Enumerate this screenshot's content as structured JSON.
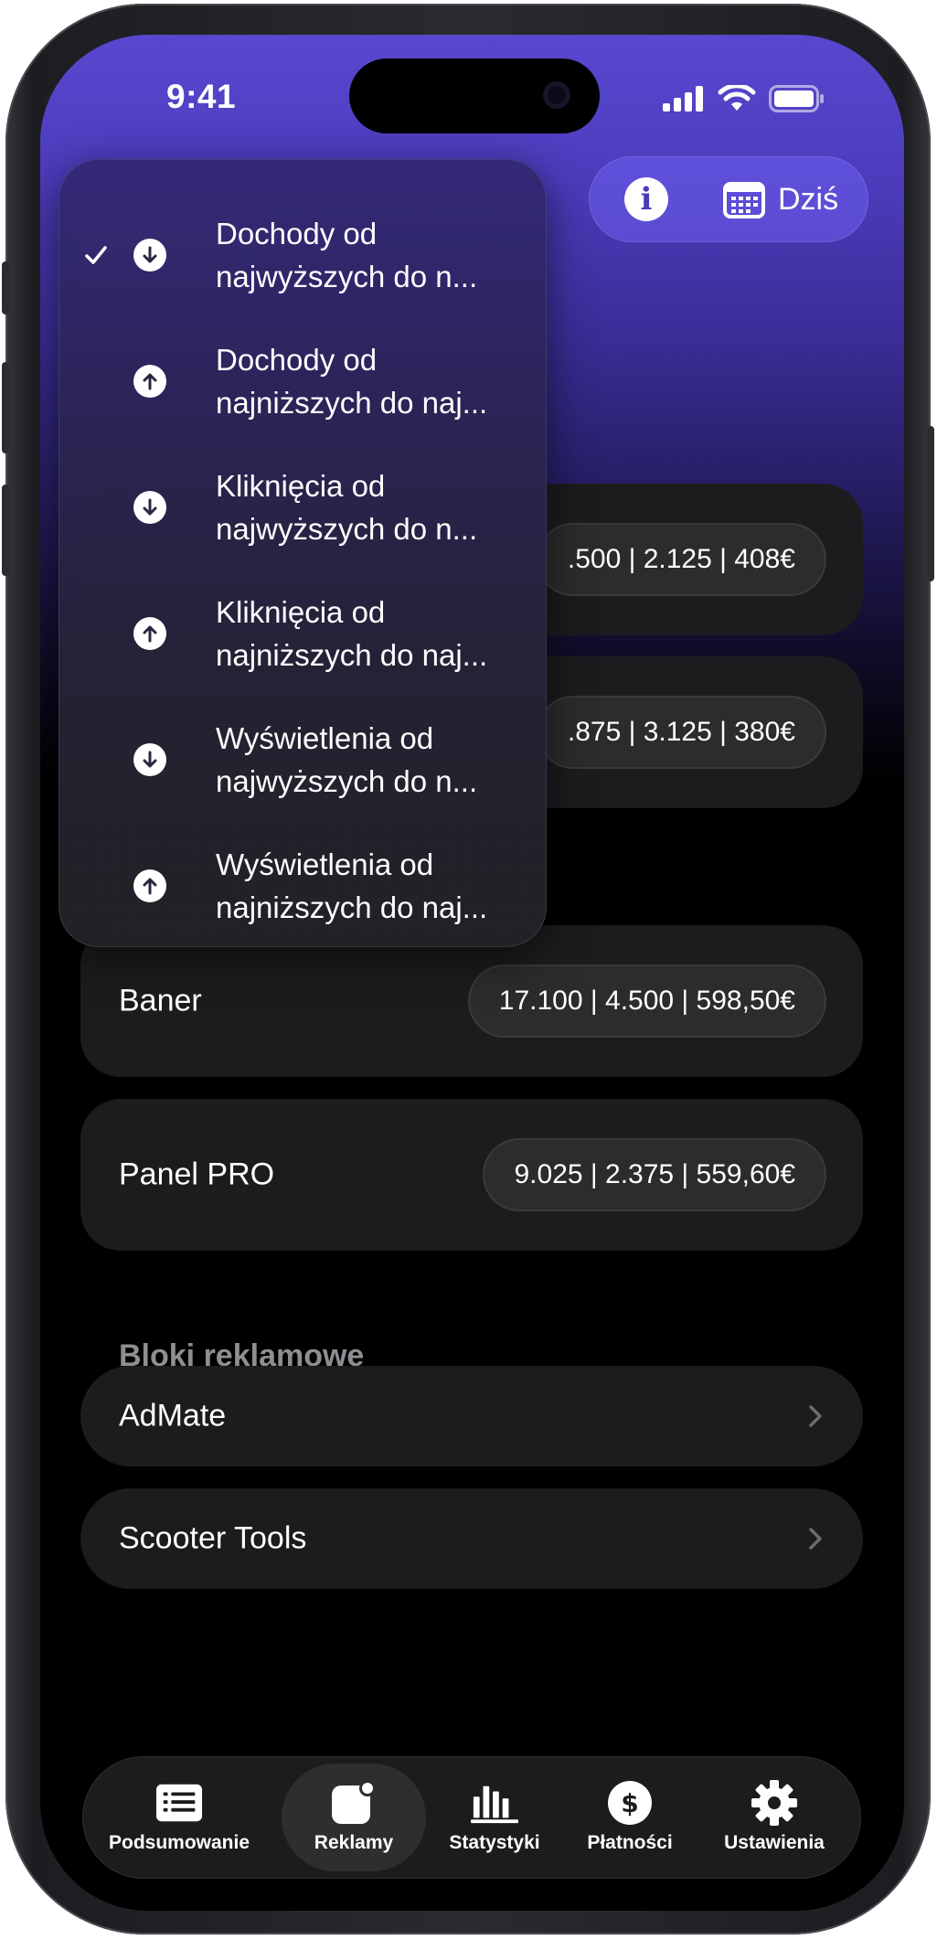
{
  "status_bar": {
    "time": "9:41"
  },
  "header": {
    "info_icon_glyph": "i",
    "date_label": "Dziś"
  },
  "sort_menu": {
    "selected_index": 0,
    "items": [
      {
        "line1": "Dochody od",
        "line2": "najwyższych do n...",
        "direction": "down",
        "checked": true
      },
      {
        "line1": "Dochody od",
        "line2": "najniższych do naj...",
        "direction": "up",
        "checked": false
      },
      {
        "line1": "Kliknięcia od",
        "line2": "najwyższych do n...",
        "direction": "down",
        "checked": false
      },
      {
        "line1": "Kliknięcia od",
        "line2": "najniższych do naj...",
        "direction": "up",
        "checked": false
      },
      {
        "line1": "Wyświetlenia od",
        "line2": "najwyższych do n...",
        "direction": "down",
        "checked": false
      },
      {
        "line1": "Wyświetlenia od",
        "line2": "najniższych do naj...",
        "direction": "up",
        "checked": false
      }
    ]
  },
  "ad_cards": [
    {
      "name": "",
      "stats": ".500 | 2.125 | 408€"
    },
    {
      "name": "",
      "stats": ".875 | 3.125 | 380€"
    },
    {
      "name": "Baner",
      "stats": "17.100 | 4.500 | 598,50€"
    },
    {
      "name": "Panel PRO",
      "stats": "9.025 | 2.375 | 559,60€"
    }
  ],
  "ad_blocks": {
    "title": "Bloki reklamowe",
    "items": [
      {
        "label": "AdMate"
      },
      {
        "label": "Scooter Tools"
      }
    ]
  },
  "tab_bar": {
    "active_index": 1,
    "tabs": [
      {
        "label": "Podsumowanie",
        "icon": "list-icon"
      },
      {
        "label": "Reklamy",
        "icon": "ads-icon"
      },
      {
        "label": "Statystyki",
        "icon": "bar-chart-icon"
      },
      {
        "label": "Płatności",
        "icon": "dollar-icon"
      },
      {
        "label": "Ustawienia",
        "icon": "gear-icon"
      }
    ]
  },
  "colors": {
    "accent_top": "#5848d0",
    "card_bg": "#1c1c1e",
    "pill_bg": "#2c2c2e",
    "secondary_text": "#8e8e93"
  }
}
